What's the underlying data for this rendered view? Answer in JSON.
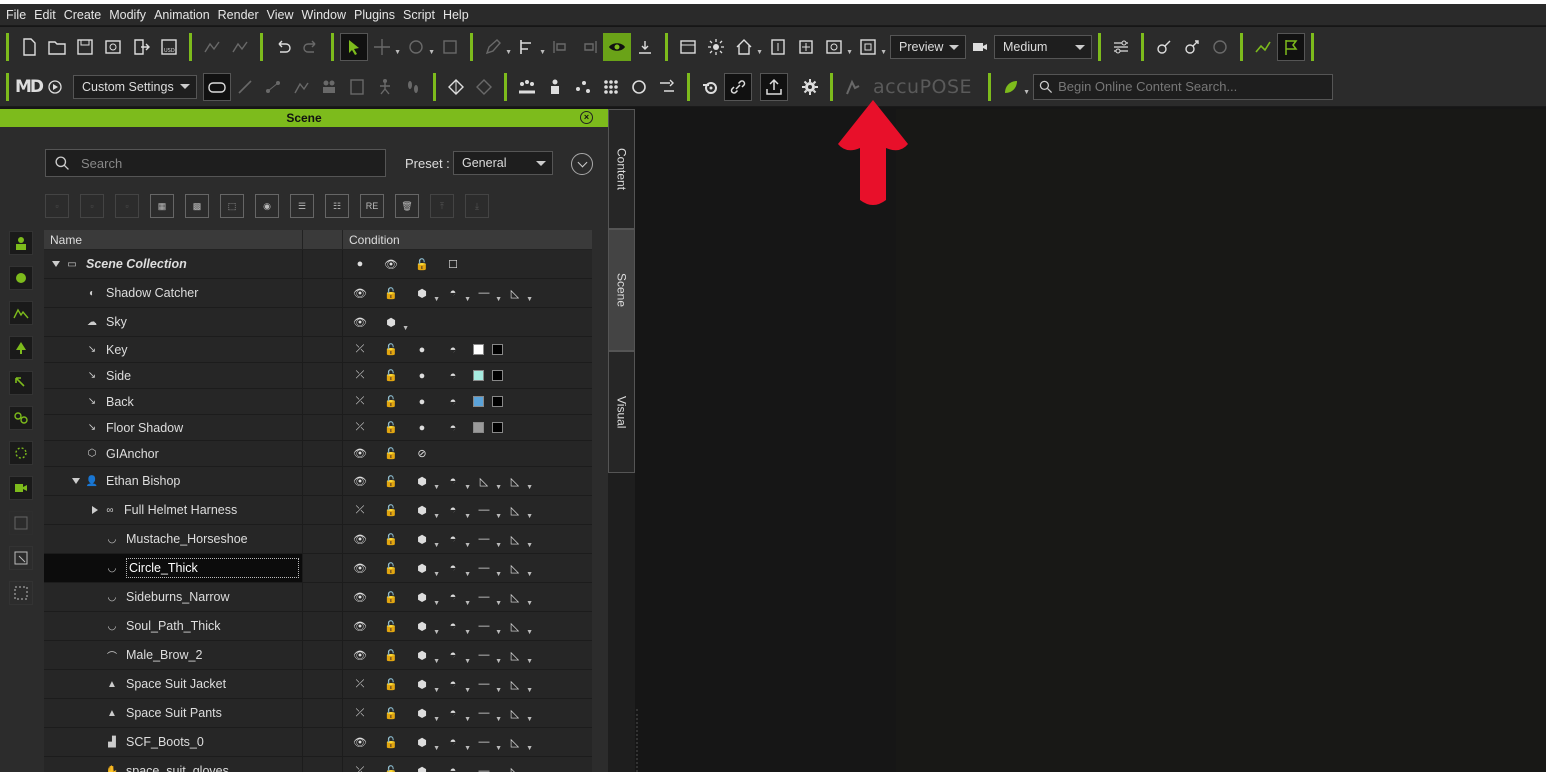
{
  "menu": [
    "File",
    "Edit",
    "Create",
    "Modify",
    "Animation",
    "Render",
    "View",
    "Window",
    "Plugins",
    "Script",
    "Help"
  ],
  "toolbar1": {
    "preview_label": "Preview",
    "quality_label": "Medium"
  },
  "toolbar2": {
    "settings_label": "Custom Settings",
    "accupose_label": "accuPOSE",
    "online_search_placeholder": "Begin Online Content Search..."
  },
  "scene_panel": {
    "title": "Scene",
    "search_placeholder": "Search",
    "preset_label": "Preset :",
    "preset_value": "General",
    "columns": {
      "name": "Name",
      "condition": "Condition"
    },
    "rows": [
      {
        "name": "Scene Collection",
        "icon": "folder-icon",
        "indent": 0,
        "expander": "down",
        "italic": true
      },
      {
        "name": "Shadow Catcher",
        "icon": "shadow-catcher-icon",
        "indent": 1
      },
      {
        "name": "Sky",
        "icon": "sky-icon",
        "indent": 1
      },
      {
        "name": "Key",
        "icon": "light-icon",
        "indent": 1,
        "swatch": "#ffffff"
      },
      {
        "name": "Side",
        "icon": "light-icon",
        "indent": 1,
        "swatch": "#a7ebe0"
      },
      {
        "name": "Back",
        "icon": "light-icon",
        "indent": 1,
        "swatch": "#5ba3d9"
      },
      {
        "name": "Floor Shadow",
        "icon": "light-icon",
        "indent": 1,
        "swatch": "#9a9a9a"
      },
      {
        "name": "GIAnchor",
        "icon": "gianchor-icon",
        "indent": 1
      },
      {
        "name": "Ethan Bishop",
        "icon": "avatar-icon",
        "indent": 1,
        "expander": "down"
      },
      {
        "name": "Full Helmet Harness",
        "icon": "accessory-icon",
        "indent": 2,
        "expander": "right"
      },
      {
        "name": "Mustache_Horseshoe",
        "icon": "hair-icon",
        "indent": 2
      },
      {
        "name": "Circle_Thick",
        "icon": "hair-icon",
        "indent": 2,
        "selected": true
      },
      {
        "name": "Sideburns_Narrow",
        "icon": "hair-icon",
        "indent": 2
      },
      {
        "name": "Soul_Path_Thick",
        "icon": "hair-icon",
        "indent": 2
      },
      {
        "name": "Male_Brow_2",
        "icon": "brow-icon",
        "indent": 2
      },
      {
        "name": "Space Suit Jacket",
        "icon": "cloth-icon",
        "indent": 2
      },
      {
        "name": "Space Suit Pants",
        "icon": "cloth-icon",
        "indent": 2
      },
      {
        "name": "SCF_Boots_0",
        "icon": "shoe-icon",
        "indent": 2
      },
      {
        "name": "space_suit_gloves",
        "icon": "glove-icon",
        "indent": 2
      }
    ]
  },
  "side_tabs": [
    "Content",
    "Scene",
    "Visual"
  ],
  "colors": {
    "accent": "#7dbb1c",
    "annotation": "#e8102a"
  }
}
